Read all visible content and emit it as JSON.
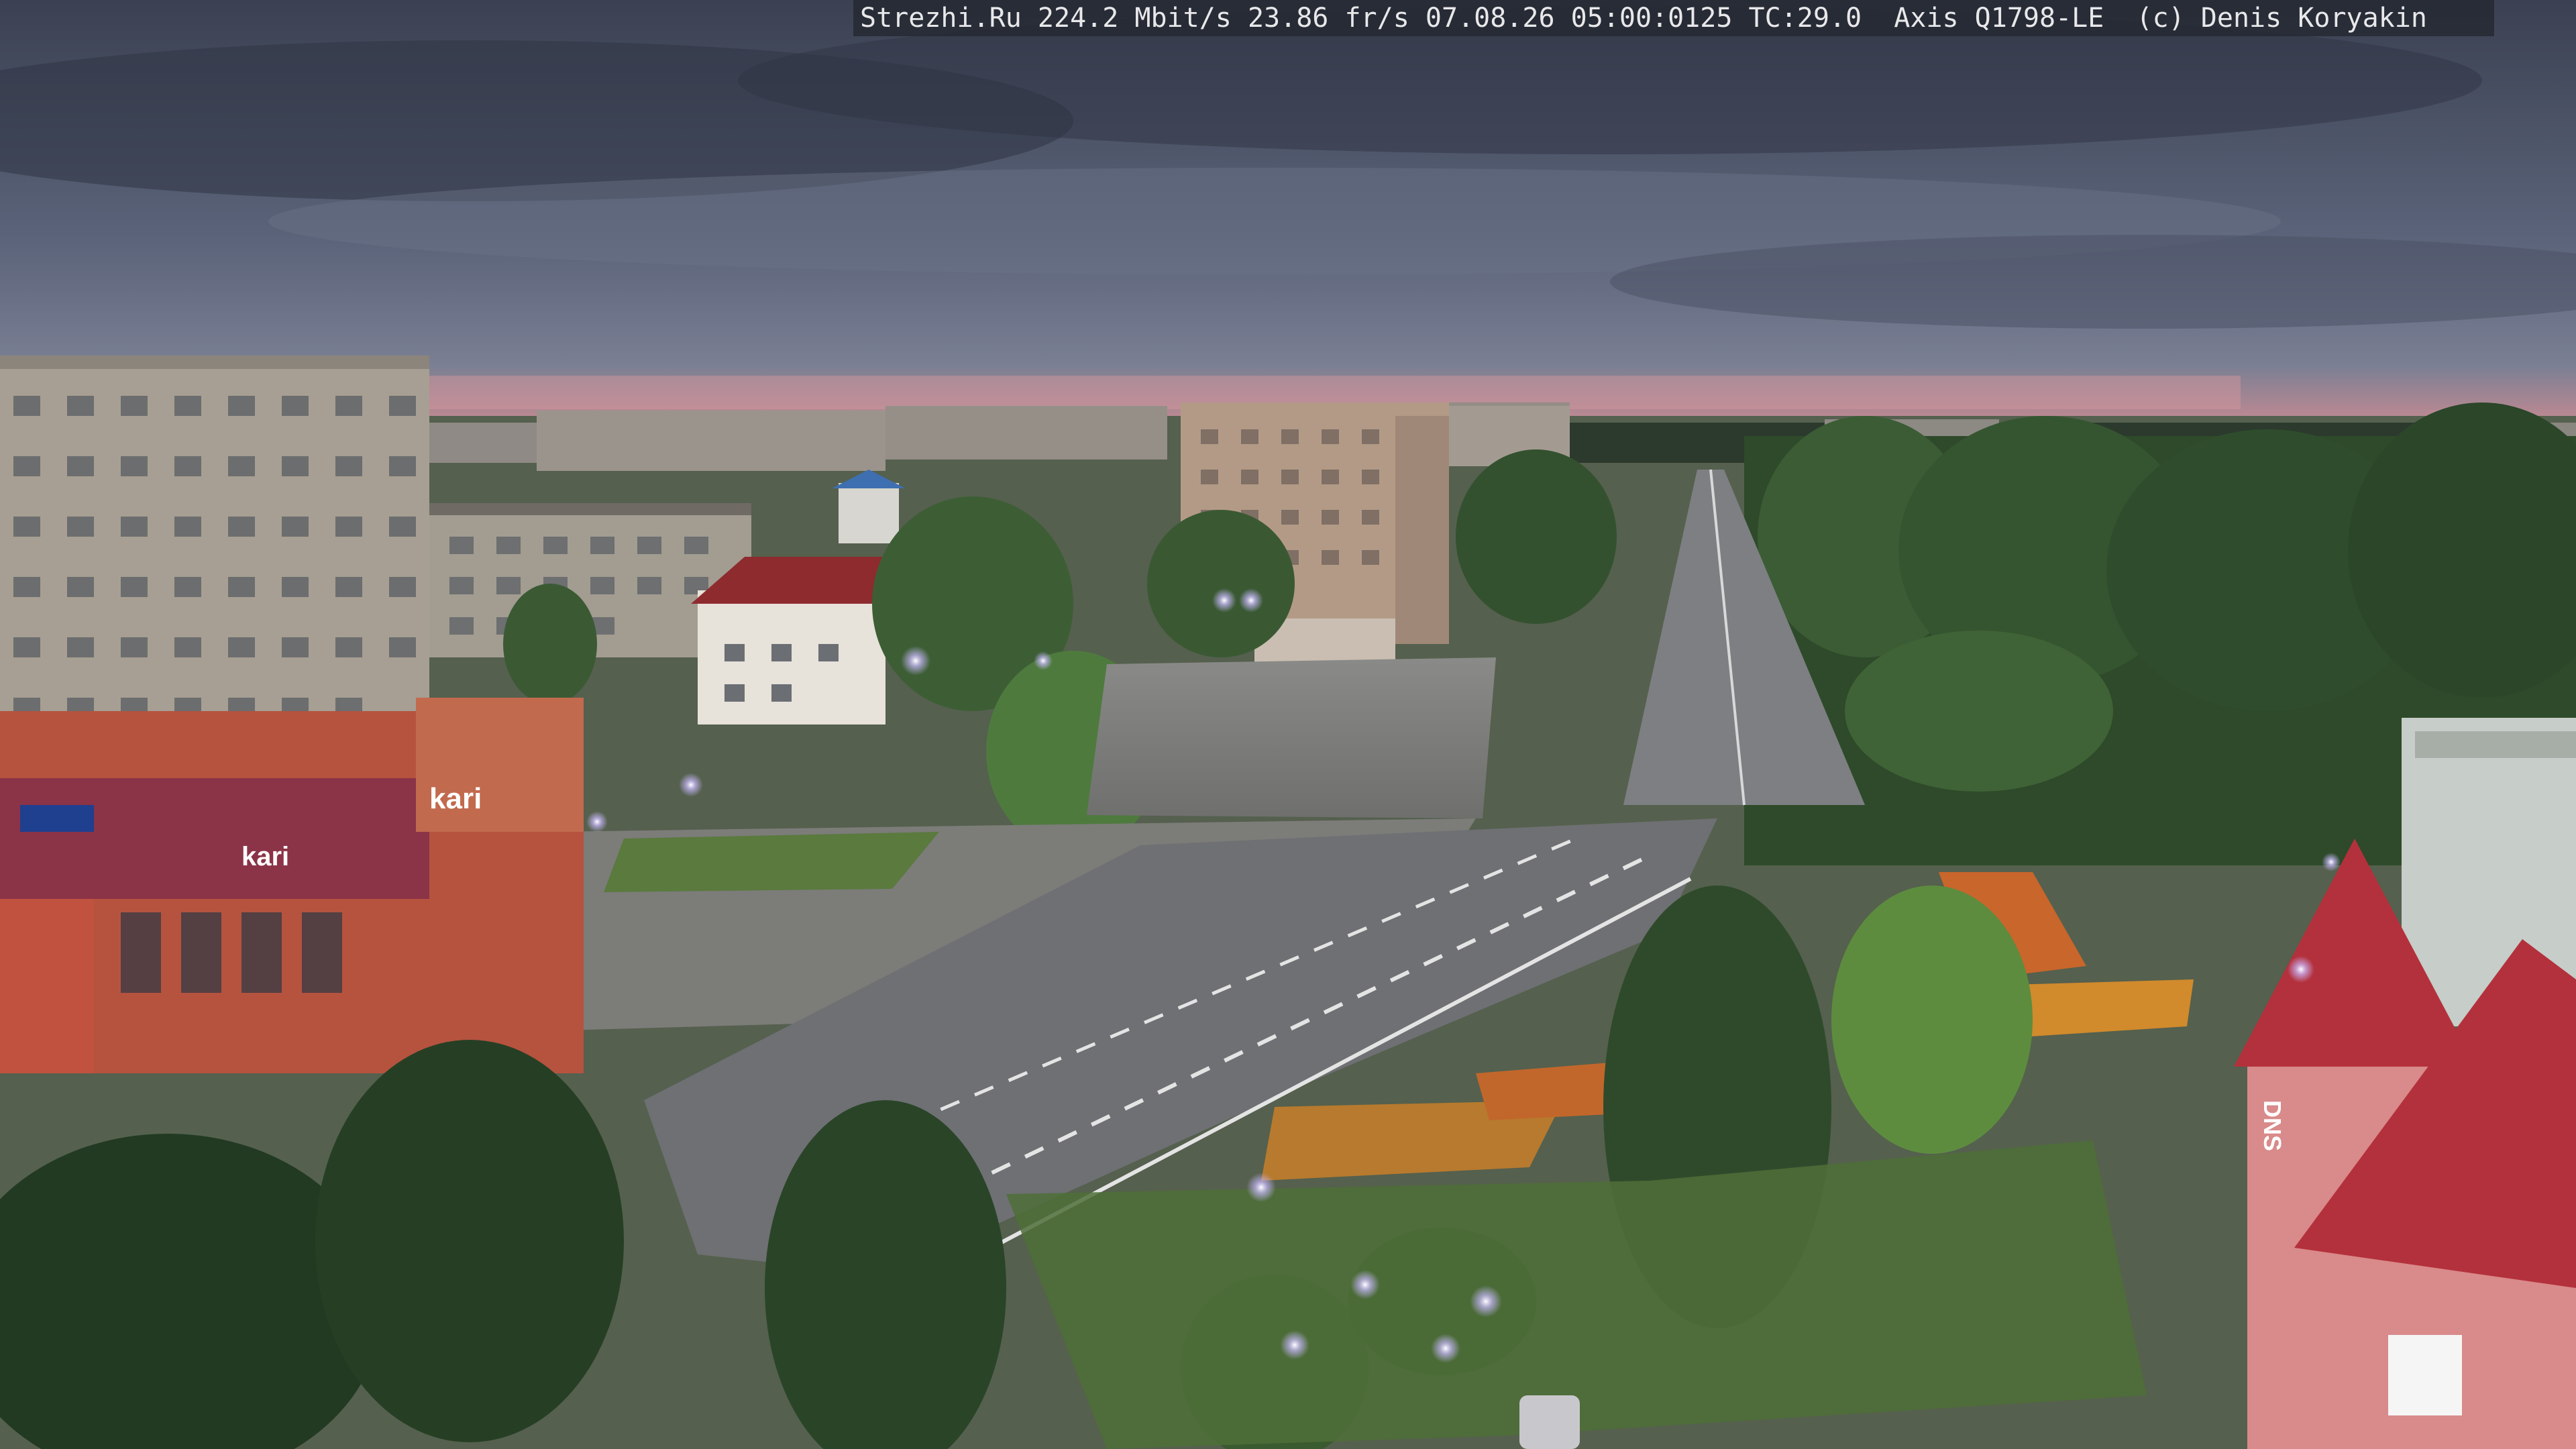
{
  "camera_overlay": {
    "text": "Strezhi.Ru 224.2 Mbit/s 23.86 fr/s 07.08.26 05:00:0125 TC:29.0  Axis Q1798-LE  (c) Denis Koryakin"
  },
  "signs": {
    "store_kari_upper": "kari",
    "store_kari_lower": "kari",
    "store_dns": "DNS"
  },
  "colors": {
    "sky_top": "#3b4152",
    "sky_mid": "#5a6379",
    "sky_horizon": "#c98b93",
    "trees": "#2e4a2a",
    "road": "#6e7073",
    "building_panel": "#a79f93",
    "storefront": "#b5533f"
  }
}
